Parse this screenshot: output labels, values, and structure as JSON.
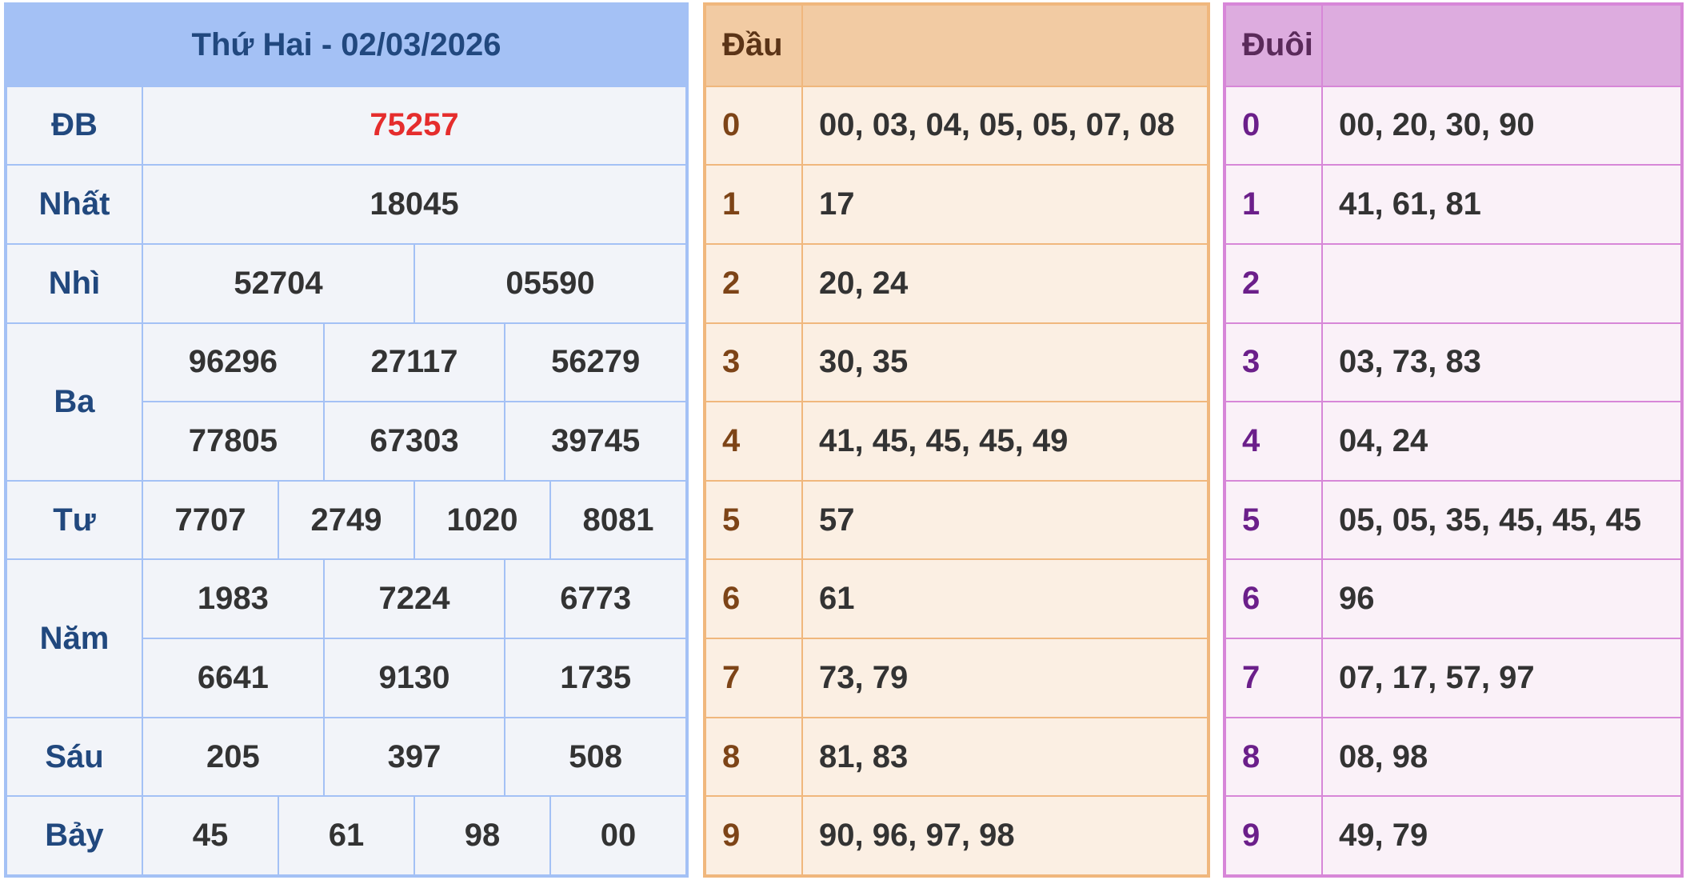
{
  "results": {
    "title": "Thứ Hai - 02/03/2026",
    "special": {
      "label": "ĐB",
      "values": [
        "75257"
      ]
    },
    "first": {
      "label": "Nhất",
      "values": [
        "18045"
      ]
    },
    "second": {
      "label": "Nhì",
      "values": [
        "52704",
        "05590"
      ]
    },
    "third": {
      "label": "Ba",
      "values": [
        "96296",
        "27117",
        "56279",
        "77805",
        "67303",
        "39745"
      ]
    },
    "fourth": {
      "label": "Tư",
      "values": [
        "7707",
        "2749",
        "1020",
        "8081"
      ]
    },
    "fifth": {
      "label": "Năm",
      "values": [
        "1983",
        "7224",
        "6773",
        "6641",
        "9130",
        "1735"
      ]
    },
    "sixth": {
      "label": "Sáu",
      "values": [
        "205",
        "397",
        "508"
      ]
    },
    "seventh": {
      "label": "Bảy",
      "values": [
        "45",
        "61",
        "98",
        "00"
      ]
    }
  },
  "dau": {
    "header": "Đầu",
    "rows": [
      {
        "key": "0",
        "list": "00, 03, 04, 05, 05, 07, 08"
      },
      {
        "key": "1",
        "list": "17"
      },
      {
        "key": "2",
        "list": "20, 24"
      },
      {
        "key": "3",
        "list": "30, 35"
      },
      {
        "key": "4",
        "list": "41, 45, 45, 45, 49"
      },
      {
        "key": "5",
        "list": "57"
      },
      {
        "key": "6",
        "list": "61"
      },
      {
        "key": "7",
        "list": "73, 79"
      },
      {
        "key": "8",
        "list": "81, 83"
      },
      {
        "key": "9",
        "list": "90, 96, 97, 98"
      }
    ]
  },
  "duoi": {
    "header": "Đuôi",
    "rows": [
      {
        "key": "0",
        "list": "00, 20, 30, 90"
      },
      {
        "key": "1",
        "list": "41, 61, 81"
      },
      {
        "key": "2",
        "list": ""
      },
      {
        "key": "3",
        "list": "03, 73, 83"
      },
      {
        "key": "4",
        "list": "04, 24"
      },
      {
        "key": "5",
        "list": "05, 05, 35, 45, 45, 45"
      },
      {
        "key": "6",
        "list": "96"
      },
      {
        "key": "7",
        "list": "07, 17, 57, 97"
      },
      {
        "key": "8",
        "list": "08, 98"
      },
      {
        "key": "9",
        "list": "49, 79"
      }
    ]
  },
  "colors": {
    "results_header": "#a4c1f5",
    "special_prize": "#e52d2d",
    "dau_header": "#f2cba3",
    "duoi_header": "#ddacdf"
  }
}
